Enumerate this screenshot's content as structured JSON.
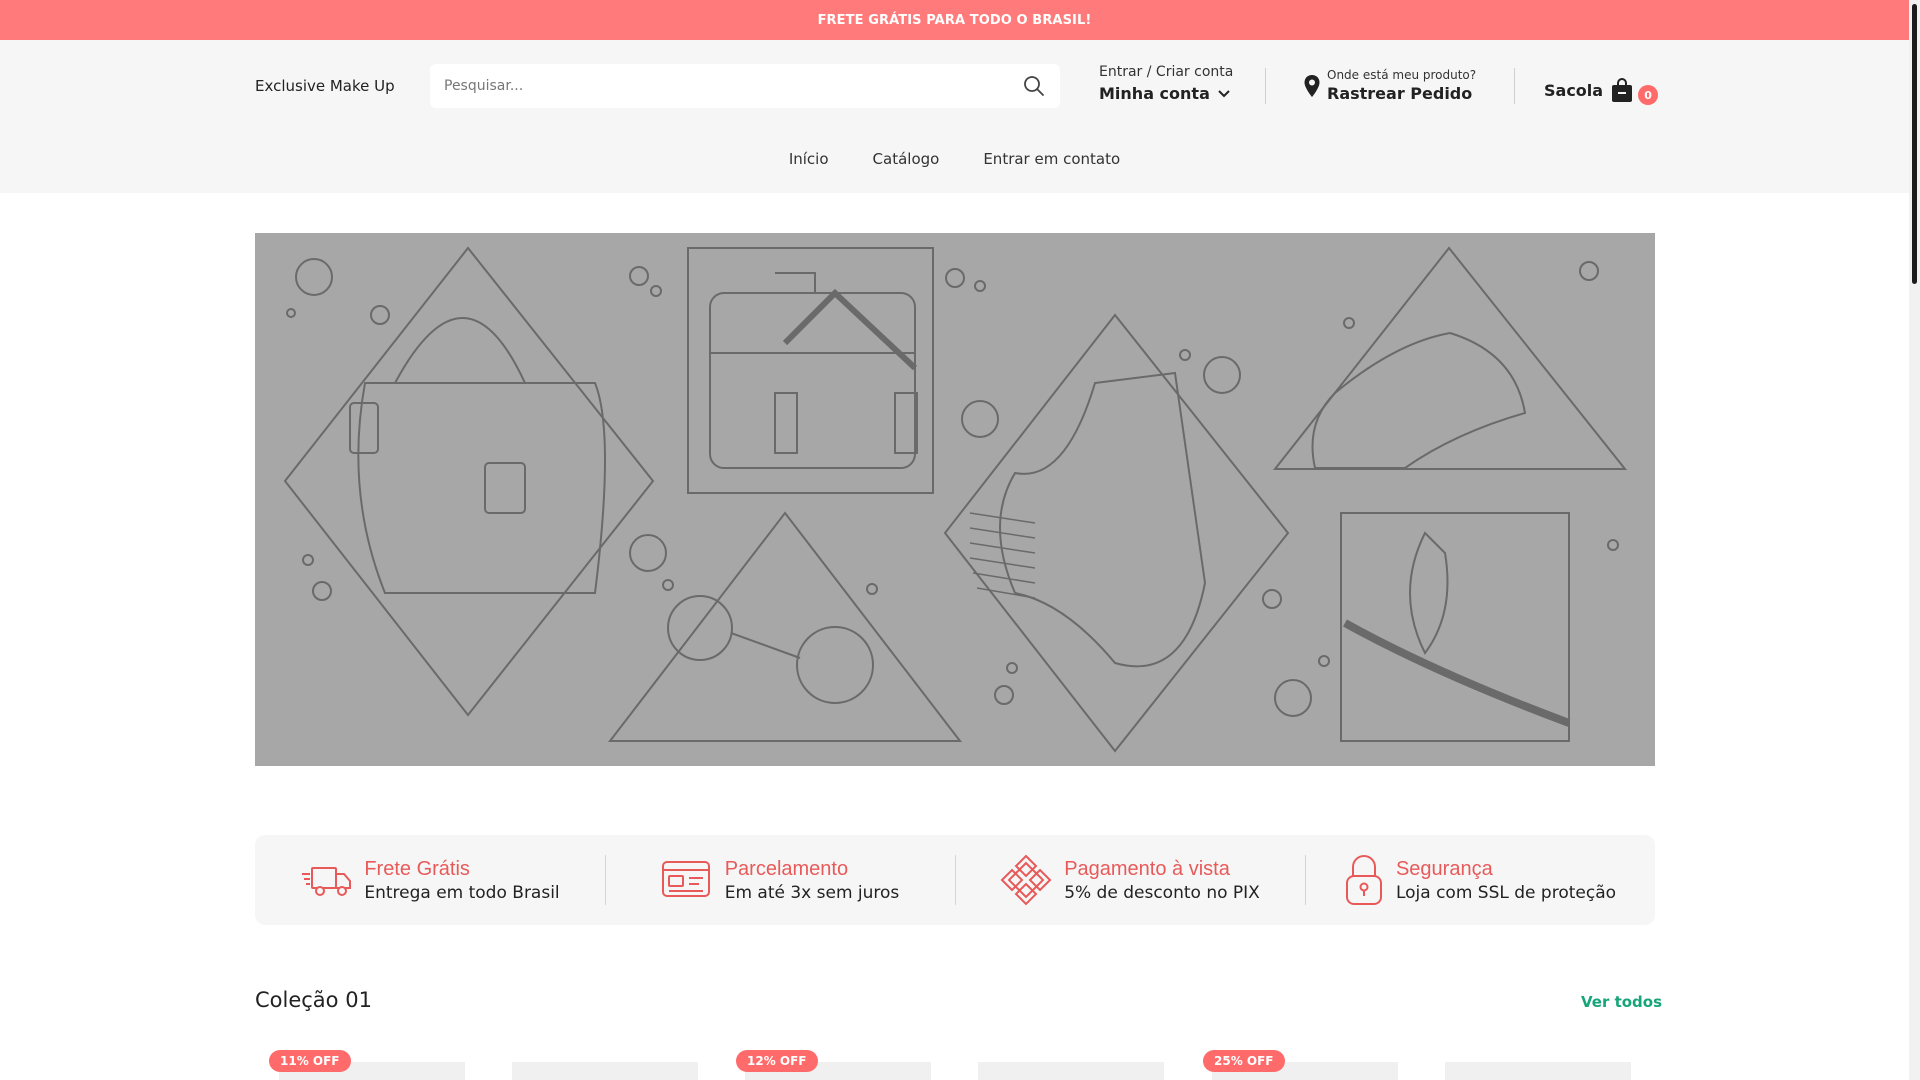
{
  "announcement": "FRETE GRÁTIS PARA TODO O BRASIL!",
  "header": {
    "brand": "Exclusive Make Up",
    "search_placeholder": "Pesquisar...",
    "account": {
      "small": "Entrar / Criar conta",
      "big": "Minha conta"
    },
    "track": {
      "small": "Onde está meu produto?",
      "big": "Rastrear Pedido"
    },
    "bag": {
      "label": "Sacola",
      "count": "0"
    }
  },
  "nav": [
    {
      "label": "Início"
    },
    {
      "label": "Catálogo"
    },
    {
      "label": "Entrar em contato"
    }
  ],
  "features": [
    {
      "title": "Frete Grátis",
      "subtitle": "Entrega em todo Brasil",
      "icon": "truck-icon"
    },
    {
      "title": "Parcelamento",
      "subtitle": "Em até 3x sem juros",
      "icon": "credit-card-icon"
    },
    {
      "title": "Pagamento à vista",
      "subtitle": "5% de desconto no PIX",
      "icon": "pix-icon"
    },
    {
      "title": "Segurança",
      "subtitle": "Loja com SSL de proteção",
      "icon": "lock-icon"
    }
  ],
  "collection": {
    "title": "Coleção 01",
    "view_all": "Ver todos"
  },
  "discounts": [
    "11% OFF",
    "12% OFF",
    "25% OFF"
  ],
  "colors": {
    "accent": "#ff7b7b",
    "badge": "#ff6b6b",
    "feature_title": "#e85a5a",
    "link": "#16a57a",
    "banner": "#a7a7a7"
  }
}
